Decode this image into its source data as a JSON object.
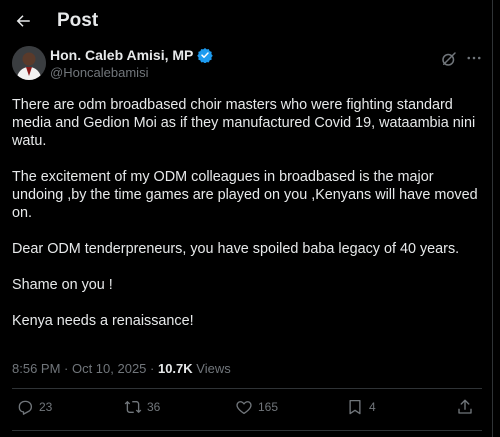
{
  "header": {
    "title": "Post"
  },
  "author": {
    "name": "Hon. Caleb Amisi, MP",
    "handle": "@Honcalebamisi"
  },
  "post": {
    "paragraphs": [
      "There are odm broadbased choir masters who were fighting standard media and Gedion Moi as if they manufactured Covid 19, wataambia nini watu.",
      "The excitement of my ODM colleagues in broadbased is the major undoing ,by the time games are played on you ,Kenyans will have moved on.",
      "Dear ODM tenderpreneurs, you have spoiled baba legacy of 40 years.",
      "Shame on you !",
      "Kenya needs a renaissance!"
    ],
    "timestamp": "8:56 PM · Oct 10, 2025 · ",
    "views_count": "10.7K",
    "views_label": " Views"
  },
  "actions": {
    "replies": "23",
    "reposts": "36",
    "likes": "165",
    "bookmarks": "4"
  },
  "colors": {
    "background": "#000000",
    "text": "#e7e9ea",
    "muted": "#71767b",
    "verified": "#1d9bf0",
    "divider": "#2f3336"
  },
  "icons": [
    "back-arrow-icon",
    "verified-badge-icon",
    "grok-icon",
    "more-icon",
    "reply-icon",
    "repost-icon",
    "like-icon",
    "bookmark-icon",
    "share-icon"
  ]
}
